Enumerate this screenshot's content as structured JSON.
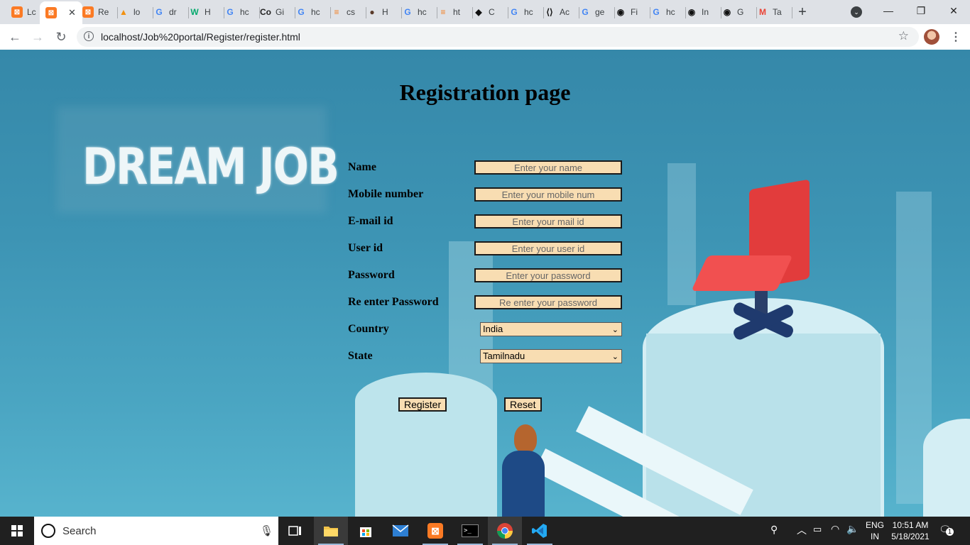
{
  "browser": {
    "tabs": [
      {
        "label": "Lc",
        "icon": "xampp-icon",
        "color": "#fb7a24"
      },
      {
        "label": "",
        "icon": "xampp-icon",
        "color": "#fb7a24",
        "active": true
      },
      {
        "label": "Re",
        "icon": "xampp-icon",
        "color": "#fb7a24"
      },
      {
        "label": "lo",
        "icon": "phpmyadmin-icon",
        "color": "#f29111"
      },
      {
        "label": "dr",
        "icon": "google-icon",
        "color": "#4285f4"
      },
      {
        "label": "H",
        "icon": "w3schools-icon",
        "color": "#04aa6d"
      },
      {
        "label": "hc",
        "icon": "google-icon",
        "color": "#4285f4"
      },
      {
        "label": "Gi",
        "icon": "codegrepper-icon",
        "color": "#222222"
      },
      {
        "label": "hc",
        "icon": "google-icon",
        "color": "#4285f4"
      },
      {
        "label": "cs",
        "icon": "stackoverflow-icon",
        "color": "#f48024"
      },
      {
        "label": "H",
        "icon": "avatar-icon",
        "color": "#5a3a2a"
      },
      {
        "label": "hc",
        "icon": "google-icon",
        "color": "#4285f4"
      },
      {
        "label": "ht",
        "icon": "stackoverflow-icon",
        "color": "#f48024"
      },
      {
        "label": "C",
        "icon": "codepen-icon",
        "color": "#111111"
      },
      {
        "label": "hc",
        "icon": "google-icon",
        "color": "#4285f4"
      },
      {
        "label": "Ac",
        "icon": "devto-icon",
        "color": "#111111"
      },
      {
        "label": "ge",
        "icon": "google-icon",
        "color": "#4285f4"
      },
      {
        "label": "Fi",
        "icon": "github-icon",
        "color": "#111111"
      },
      {
        "label": "hc",
        "icon": "google-icon",
        "color": "#4285f4"
      },
      {
        "label": "In",
        "icon": "github-icon",
        "color": "#111111"
      },
      {
        "label": "G",
        "icon": "github-icon",
        "color": "#111111"
      },
      {
        "label": "Ta",
        "icon": "gmail-icon",
        "color": "#ea4335"
      }
    ],
    "new_tab": "+",
    "url": "localhost/Job%20portal/Register/register.html"
  },
  "page": {
    "title": "Registration page",
    "logo_text": "DREAM JOB",
    "fields": [
      {
        "label": "Name",
        "placeholder": "Enter your name"
      },
      {
        "label": "Mobile number",
        "placeholder": "Enter your mobile num"
      },
      {
        "label": "E-mail id",
        "placeholder": "Enter your mail id"
      },
      {
        "label": "User id",
        "placeholder": "Enter your user id"
      },
      {
        "label": "Password",
        "placeholder": "Enter your password"
      },
      {
        "label": "Re enter Password",
        "placeholder": "Re enter your password"
      }
    ],
    "country": {
      "label": "Country",
      "value": "India"
    },
    "state": {
      "label": "State",
      "value": "Tamilnadu"
    },
    "register_label": "Register",
    "reset_label": "Reset"
  },
  "taskbar": {
    "search_text": "Search",
    "lang_top": "ENG",
    "lang_bottom": "IN",
    "time": "10:51 AM",
    "date": "5/18/2021",
    "notification_count": "1"
  }
}
